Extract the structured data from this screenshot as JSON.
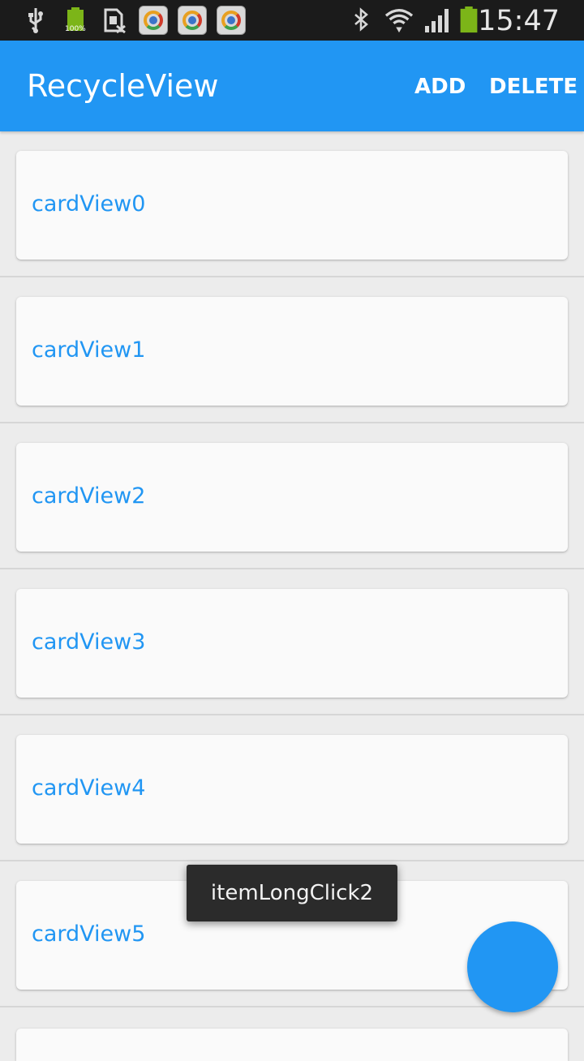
{
  "status_bar": {
    "time": "15:47",
    "battery_level_label": "100%",
    "icons": [
      "usb-icon",
      "battery-full-icon",
      "no-sim-icon",
      "app-notification-icon",
      "app-notification-icon",
      "app-notification-icon",
      "bluetooth-icon",
      "wifi-icon",
      "signal-icon",
      "battery-icon"
    ]
  },
  "app_bar": {
    "title": "RecycleView",
    "actions": {
      "add": "ADD",
      "delete": "DELETE"
    },
    "color": "#2196f3"
  },
  "list": {
    "items": [
      {
        "label": "cardView0"
      },
      {
        "label": "cardView1"
      },
      {
        "label": "cardView2"
      },
      {
        "label": "cardView3"
      },
      {
        "label": "cardView4"
      },
      {
        "label": "cardView5"
      },
      {
        "label": ""
      }
    ]
  },
  "toast": {
    "text": "itemLongClick2"
  },
  "fab": {
    "color": "#2196f3"
  }
}
